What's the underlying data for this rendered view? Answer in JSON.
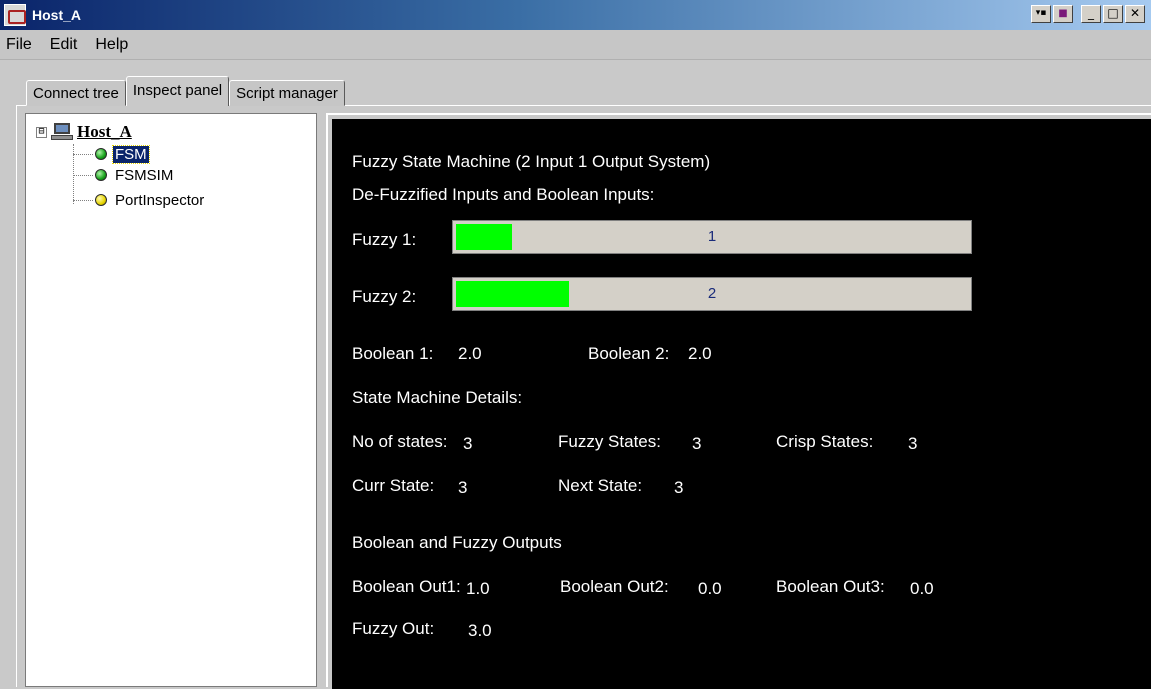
{
  "window": {
    "title": "Host_A",
    "controls": {
      "extra": "▼▣",
      "minimize": "_",
      "maximize": "□",
      "close": "✕"
    }
  },
  "menu": [
    "File",
    "Edit",
    "Help"
  ],
  "tabs": [
    {
      "label": "Connect tree",
      "active": false
    },
    {
      "label": "Inspect panel",
      "active": true
    },
    {
      "label": "Script manager",
      "active": false
    }
  ],
  "tree": {
    "root": "Host_A",
    "expander": "⊟",
    "children": [
      {
        "label": "FSM",
        "status": "green",
        "selected": true
      },
      {
        "label": "FSMSIM",
        "status": "green",
        "selected": false
      },
      {
        "label": "PortInspector",
        "status": "yellow",
        "selected": false
      }
    ]
  },
  "inspect": {
    "title": "Fuzzy State Machine (2 Input 1 Output System)",
    "inputs_heading": "De-Fuzzified Inputs and Boolean Inputs:",
    "fuzzy1": {
      "label": "Fuzzy 1:",
      "value": "1",
      "fill_fraction": 0.11
    },
    "fuzzy2": {
      "label": "Fuzzy 2:",
      "value": "2",
      "fill_fraction": 0.22
    },
    "boolean1": {
      "label": "Boolean 1:",
      "value": "2.0"
    },
    "boolean2": {
      "label": "Boolean 2:",
      "value": "2.0"
    },
    "details_heading": "State Machine Details:",
    "num_states": {
      "label": "No of states:",
      "value": "3"
    },
    "fuzzy_states": {
      "label": "Fuzzy States:",
      "value": "3"
    },
    "crisp_states": {
      "label": "Crisp States:",
      "value": "3"
    },
    "curr_state": {
      "label": "Curr State:",
      "value": "3"
    },
    "next_state": {
      "label": "Next State:",
      "value": "3"
    },
    "outputs_heading": "Boolean and Fuzzy Outputs",
    "bool_out1": {
      "label": "Boolean Out1:",
      "value": "1.0"
    },
    "bool_out2": {
      "label": "Boolean Out2:",
      "value": "0.0"
    },
    "bool_out3": {
      "label": "Boolean Out3:",
      "value": "0.0"
    },
    "fuzzy_out": {
      "label": "Fuzzy Out:",
      "value": "3.0"
    }
  },
  "colors": {
    "bar_fill": "#00ff00",
    "panel_bg": "#000000",
    "selection": "#0a246a"
  }
}
